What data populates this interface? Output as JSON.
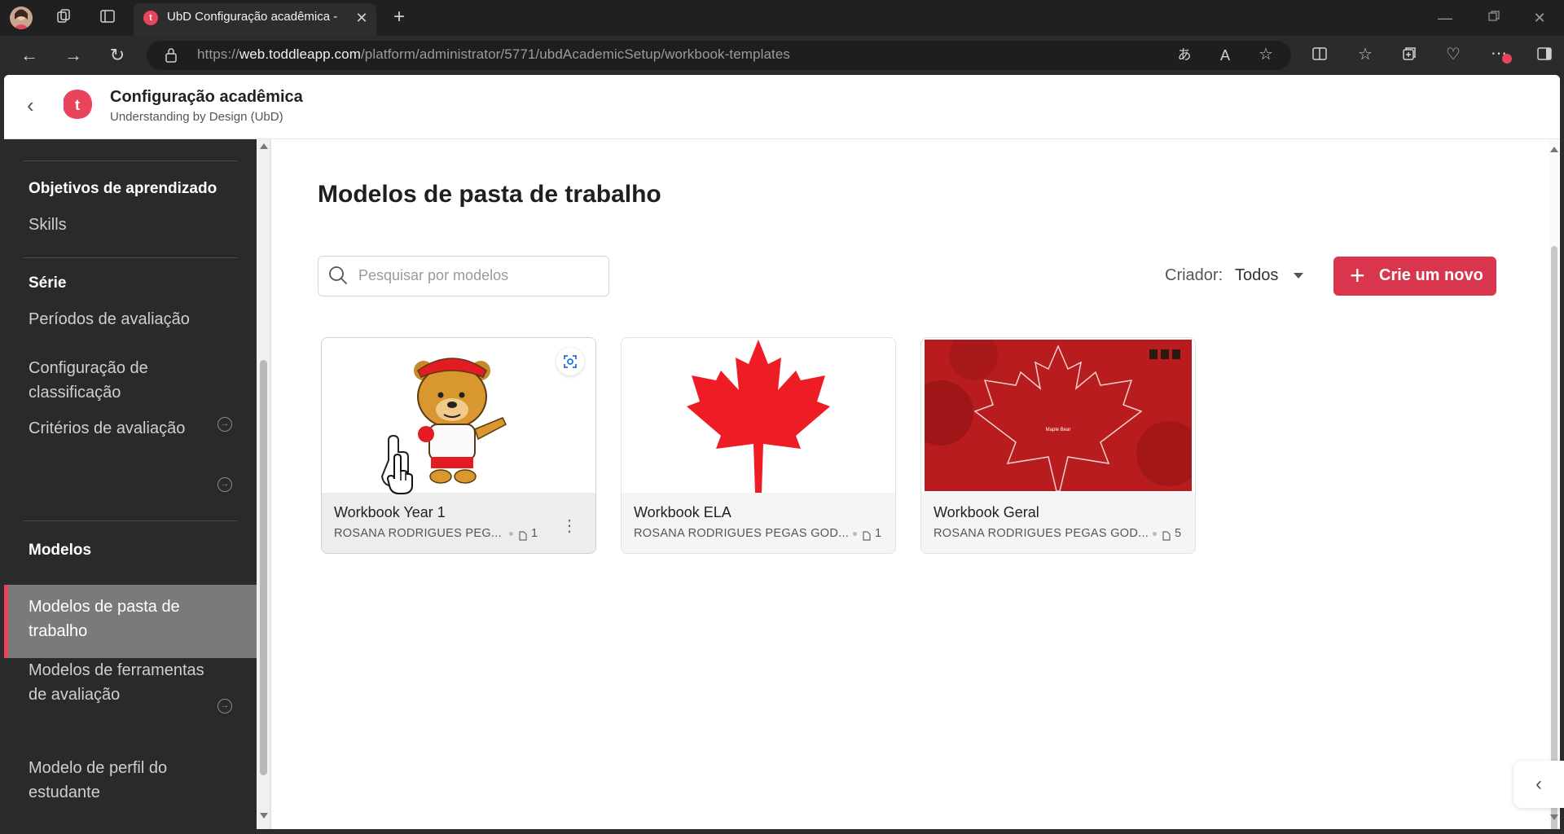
{
  "browser": {
    "tab_title": "UbD Configuração acadêmica - M",
    "tab_favicon": "t",
    "url_prefix": "https://",
    "url_host": "web.toddleapp.com",
    "url_path": "/platform/administrator/5771/ubdAcademicSetup/workbook-templates"
  },
  "header": {
    "title": "Configuração acadêmica",
    "subtitle": "Understanding by Design (UbD)",
    "logo_letter": "t"
  },
  "sidebar": {
    "sections": [
      {
        "title": "Objetivos de aprendizado",
        "items": [
          "Skills"
        ]
      },
      {
        "title": "Série",
        "items": [
          "Períodos de avaliação",
          "Configuração de classificação",
          "Critérios de avaliação"
        ]
      },
      {
        "title": "Modelos",
        "items": [
          "Modelos de pasta de trabalho",
          "Modelos de ferramentas de avaliação",
          "Modelo de perfil do estudante"
        ]
      }
    ]
  },
  "main": {
    "title": "Modelos de pasta de trabalho",
    "search_placeholder": "Pesquisar por modelos",
    "creator_label": "Criador:",
    "creator_value": "Todos",
    "new_button": "Crie um novo",
    "cards": [
      {
        "title": "Workbook Year 1",
        "author": "ROSANA RODRIGUES PEG...",
        "count": "1"
      },
      {
        "title": "Workbook ELA",
        "author": "ROSANA RODRIGUES PEGAS GOD...",
        "count": "1"
      },
      {
        "title": "Workbook Geral",
        "author": "ROSANA RODRIGUES PEGAS GOD...",
        "count": "5",
        "thumb_text": "Maple Bear"
      }
    ]
  },
  "colors": {
    "accent": "#d9364e",
    "sidebar_bg": "#2a2a2a",
    "active_item_bg": "#7a7a7a"
  }
}
